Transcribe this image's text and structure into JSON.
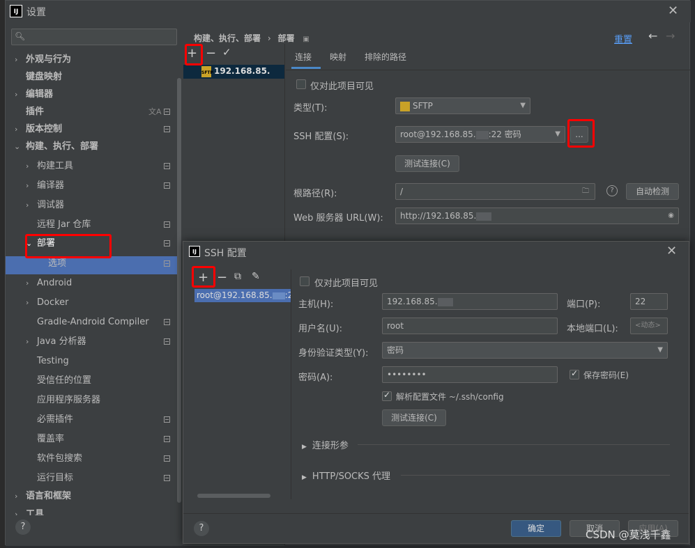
{
  "window": {
    "logo": "IJ",
    "title": "设置"
  },
  "sidebar": {
    "search_placeholder": "",
    "items": [
      {
        "label": "外观与行为"
      },
      {
        "label": "键盘映射"
      },
      {
        "label": "编辑器"
      },
      {
        "label": "插件"
      },
      {
        "label": "版本控制"
      },
      {
        "label": "构建、执行、部署"
      },
      {
        "label": "构建工具"
      },
      {
        "label": "编译器"
      },
      {
        "label": "调试器"
      },
      {
        "label": "远程 Jar 仓库"
      },
      {
        "label": "部署"
      },
      {
        "label": "选项"
      },
      {
        "label": "Android"
      },
      {
        "label": "Docker"
      },
      {
        "label": "Gradle-Android Compiler"
      },
      {
        "label": "Java 分析器"
      },
      {
        "label": "Testing"
      },
      {
        "label": "受信任的位置"
      },
      {
        "label": "应用程序服务器"
      },
      {
        "label": "必需插件"
      },
      {
        "label": "覆盖率"
      },
      {
        "label": "软件包搜索"
      },
      {
        "label": "运行目标"
      },
      {
        "label": "语言和框架"
      },
      {
        "label": "工具"
      }
    ]
  },
  "header": {
    "breadcrumb_parent": "构建、执行、部署",
    "breadcrumb_sep": "›",
    "breadcrumb_current": "部署",
    "reset": "重置"
  },
  "deploy": {
    "server_name": "192.168.85.",
    "server_icon_text": "SFTP"
  },
  "tabs": [
    "连接",
    "映射",
    "排除的路径"
  ],
  "connection": {
    "visible_only_label": "仅对此项目可见",
    "type_label": "类型(T):",
    "type_value": "SFTP",
    "ssh_label": "SSH 配置(S):",
    "ssh_value": "root@192.168.85.",
    "ssh_value_suffix": ":22 密码",
    "more_button": "...",
    "test_button": "测试连接(C)",
    "root_label": "根路径(R):",
    "root_value": "/",
    "auto_detect": "自动检测",
    "web_url_label": "Web 服务器 URL(W):",
    "web_url_value": "http://192.168.85."
  },
  "ssh_dialog": {
    "title": "SSH 配置",
    "selected_entry": "root@192.168.85.",
    "selected_entry_suffix": ":2",
    "visible_only_label": "仅对此项目可见",
    "host_label": "主机(H):",
    "host_value": "192.168.85.",
    "port_label": "端口(P):",
    "port_value": "22",
    "user_label": "用户名(U):",
    "user_value": "root",
    "local_port_label": "本地端口(L):",
    "local_port_value": "<动态>",
    "auth_label": "身份验证类型(Y):",
    "auth_value": "密码",
    "password_label": "密码(A):",
    "password_value": "••••••••",
    "save_password_label": "保存密码(E)",
    "parse_config_label": "解析配置文件 ~/.ssh/config",
    "test_button": "测试连接(C)",
    "section_connection_params": "连接形参",
    "section_proxy": "HTTP/SOCKS 代理",
    "ok_button": "确定",
    "cancel_button": "取消",
    "apply_button": "应用(A)"
  },
  "watermark": "CSDN @莫浅千鑫"
}
